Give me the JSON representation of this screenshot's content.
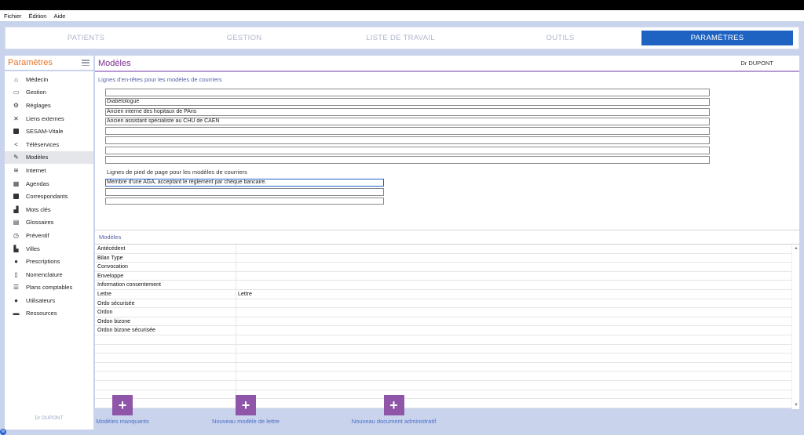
{
  "menubar": {
    "items": [
      "Fichier",
      "Édition",
      "Aide"
    ]
  },
  "nav": {
    "tabs": [
      {
        "label": "PATIENTS",
        "active": false
      },
      {
        "label": "GESTION",
        "active": false
      },
      {
        "label": "LISTE DE TRAVAIL",
        "active": false
      },
      {
        "label": "OUTILS",
        "active": false
      },
      {
        "label": "PARAMÈTRES",
        "active": true
      }
    ]
  },
  "sidebar": {
    "title": "Paramètres",
    "items": [
      {
        "label": "Médecin",
        "icon": "home-icon"
      },
      {
        "label": "Gestion",
        "icon": "inbox-icon"
      },
      {
        "label": "Réglages",
        "icon": "cogs-icon"
      },
      {
        "label": "Liens externes",
        "icon": "expand-icon"
      },
      {
        "label": "SESAM-Vitale",
        "icon": "card-icon"
      },
      {
        "label": "Téléservices",
        "icon": "share-icon"
      },
      {
        "label": "Modèles",
        "icon": "edit-icon",
        "active": true
      },
      {
        "label": "Internet",
        "icon": "wifi-icon"
      },
      {
        "label": "Agendas",
        "icon": "calendar-icon"
      },
      {
        "label": "Correspondants",
        "icon": "address-book-icon"
      },
      {
        "label": "Mots clés",
        "icon": "bar-chart-icon"
      },
      {
        "label": "Glossaires",
        "icon": "clipboard-icon"
      },
      {
        "label": "Préventif",
        "icon": "clock-icon"
      },
      {
        "label": "Villes",
        "icon": "city-icon"
      },
      {
        "label": "Prescriptions",
        "icon": "pills-icon"
      },
      {
        "label": "Nomenclature",
        "icon": "document-icon"
      },
      {
        "label": "Plans comptables",
        "icon": "list-icon"
      },
      {
        "label": "Utilisateurs",
        "icon": "users-icon"
      },
      {
        "label": "Ressources",
        "icon": "car-icon"
      }
    ],
    "footer": "Dr DUPONT"
  },
  "main": {
    "title": "Modèles",
    "user": "Dr DUPONT",
    "header_section_label": "Lignes d'en-têtes pour les modèles de courriers",
    "header_lines": [
      "",
      "Diabétologue",
      "Ancien interne des hopitaux de PAris",
      "Ancien assistant spécialiste au CHU de CAEN",
      "",
      "",
      "",
      ""
    ],
    "footer_section_label": "Lignes de pied de page pour les modèles de courriers",
    "footer_lines": [
      "Membre d'une AGA, acceptant le règlement par chèque bancaire.",
      "",
      ""
    ],
    "modeles_label": "Modèles",
    "modeles_rows": [
      [
        "Antécédent",
        ""
      ],
      [
        "Bilan Type",
        ""
      ],
      [
        "Convocation",
        ""
      ],
      [
        "Enveloppe",
        ""
      ],
      [
        "Information consentement",
        ""
      ],
      [
        "Lettre",
        "Lettre"
      ],
      [
        "Ordo sécurisée",
        ""
      ],
      [
        "Ordon",
        ""
      ],
      [
        "Ordon bizone",
        ""
      ],
      [
        "Ordon bizone sécurisée",
        ""
      ],
      [
        "",
        ""
      ],
      [
        "",
        ""
      ],
      [
        "",
        ""
      ],
      [
        "",
        ""
      ],
      [
        "",
        ""
      ],
      [
        "",
        ""
      ],
      [
        "",
        ""
      ],
      [
        "",
        ""
      ]
    ]
  },
  "actions": [
    {
      "label": "Modèles manquants",
      "icon": "plus-icon"
    },
    {
      "label": "Nouveau modèle de lettre",
      "icon": "plus-icon"
    },
    {
      "label": "Nouveau document administratif",
      "icon": "plus-icon"
    }
  ],
  "colors": {
    "accent_blue": "#1e63c2",
    "sidebar_title": "#e8732a",
    "main_title": "#7b2f8e",
    "action_button": "#8e55a8",
    "background": "#c9d3ec"
  }
}
